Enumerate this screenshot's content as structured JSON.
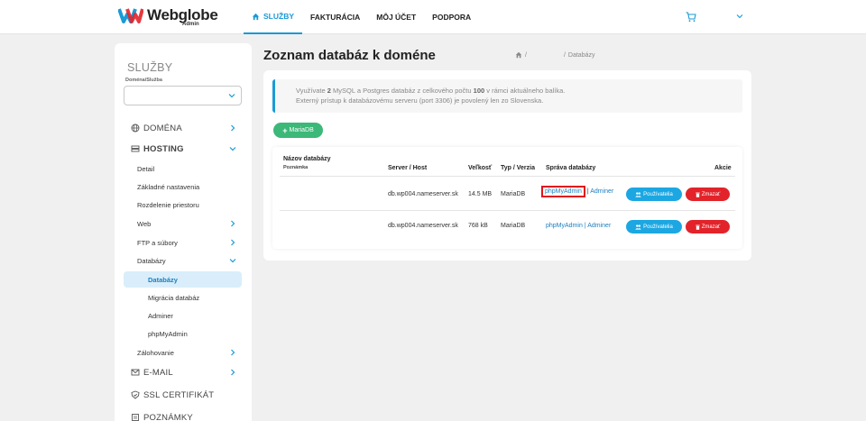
{
  "brand": {
    "name": "Webglobe",
    "sub": "Admin",
    "colors": {
      "accent": "#1a9ad6",
      "success": "#3cb878",
      "danger": "#e2232a",
      "info_btn": "#1ca7e2",
      "highlight": "#e0161d"
    }
  },
  "nav": {
    "items": [
      {
        "label": "SLUŽBY",
        "icon": "home-icon"
      },
      {
        "label": "FAKTURÁCIA"
      },
      {
        "label": "MÔJ ÚČET"
      },
      {
        "label": "PODPORA"
      }
    ]
  },
  "sidebar": {
    "title": "SLUŽBY",
    "select_label": "Doména/Služba",
    "select_value": "",
    "items": [
      {
        "label": "DOMÉNA",
        "icon": "globe-icon"
      },
      {
        "label": "HOSTING",
        "icon": "server-icon"
      },
      {
        "label": "Detail"
      },
      {
        "label": "Základné nastavenia"
      },
      {
        "label": "Rozdelenie priestoru"
      },
      {
        "label": "Web"
      },
      {
        "label": "FTP a súbory"
      },
      {
        "label": "Databázy"
      },
      {
        "label": "Databázy"
      },
      {
        "label": "Migrácia databáz"
      },
      {
        "label": "Adminer"
      },
      {
        "label": "phpMyAdmin"
      },
      {
        "label": "Zálohovanie"
      },
      {
        "label": "E-MAIL",
        "icon": "mail-icon"
      },
      {
        "label": "SSL CERTIFIKÁT",
        "icon": "shield-icon"
      },
      {
        "label": "POZNÁMKY",
        "icon": "notes-icon"
      }
    ]
  },
  "main": {
    "title": "Zoznam databáz k doméne",
    "breadcrumb": {
      "sep1": "/",
      "sep2": "/",
      "current": "Databázy"
    },
    "info": {
      "l1_a": "Využívate ",
      "l1_b": "2",
      "l1_c": " MySQL a Postgres databáz z celkového počtu ",
      "l1_d": "100",
      "l1_e": " v rámci aktuálneho balíka.",
      "l2": "Externý prístup k databázovému serveru (port 3306) je povolený len zo Slovenska."
    },
    "add_button": "MariaDB",
    "table": {
      "headers": {
        "name": "Názov databázy",
        "note": "Poznámka",
        "server": "Server / Host",
        "size": "Veľkosť",
        "type": "Typ / Verzia",
        "manage": "Správa databázy",
        "actions": "Akcie"
      },
      "rows": [
        {
          "server": "db.wp004.nameserver.sk",
          "size": "14.5 MB",
          "type": "MariaDB",
          "pma": "phpMyAdmin",
          "sep": "|",
          "adminer": "Adminer",
          "users": "Používatelia",
          "delete": "Zmazať"
        },
        {
          "server": "db.wp004.nameserver.sk",
          "size": "768 kB",
          "type": "MariaDB",
          "pma": "phpMyAdmin",
          "sep": "|",
          "adminer": "Adminer",
          "users": "Používatelia",
          "delete": "Zmazať"
        }
      ]
    }
  }
}
